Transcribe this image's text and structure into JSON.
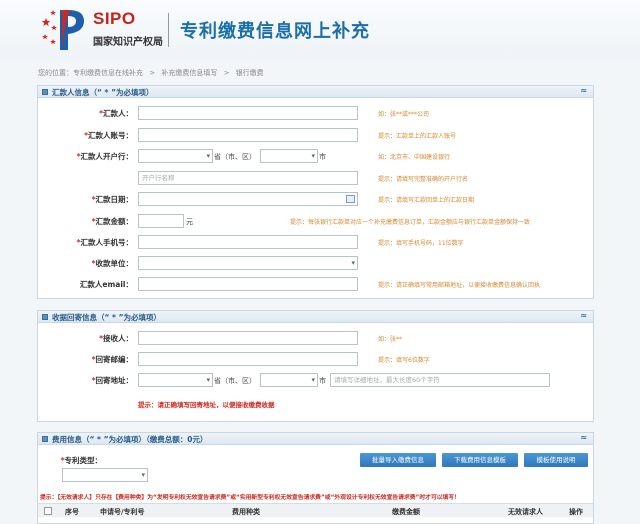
{
  "header": {
    "brand": "SIPO",
    "org": "国家知识产权局",
    "title": "专利缴费信息网上补充"
  },
  "breadcrumb": [
    "您的位置：专利缴费信息在线补充",
    ">",
    "补充缴费信息填写",
    ">",
    "银行缴费"
  ],
  "payer": {
    "title": "汇款人信息（“ * ”为必填项）",
    "collapse": "≈",
    "fields": {
      "name": {
        "label": "汇款人：",
        "hint": "如：张**或***公司"
      },
      "account": {
        "label": "汇款人账号：",
        "hint": "提示：汇款单上的汇款人账号"
      },
      "bank": {
        "label": "汇款人开户行：",
        "prov": "省（市、区）",
        "city": "市",
        "hint": "如：北京市、中国建设银行",
        "bank_placeholder": "开户行名称",
        "bank_hint": "提示：请填写完整准确的开户行名"
      },
      "date": {
        "label": "汇款日期：",
        "hint": "提示：请填写汇款回单上的汇款日期"
      },
      "amount": {
        "label": "汇款金额：",
        "unit": "元",
        "hint": "提示：每张银行汇款单对应一个补充缴费信息订单，汇款金额应与银行汇款单金额保持一致"
      },
      "phone": {
        "label": "汇款人手机号：",
        "hint": "提示：填写手机号码，11位数字"
      },
      "unit": {
        "label": "收款单位："
      },
      "email": {
        "label": "汇款人email：",
        "hint": "提示：请正确填写常用邮箱地址，以便接收缴费信息确认回执"
      }
    }
  },
  "receipt": {
    "title": "收据回寄信息（“ * ”为必填项）",
    "collapse": "≈",
    "fields": {
      "receiver": {
        "label": "接收人：",
        "hint": "如：张**"
      },
      "zip": {
        "label": "回寄邮编：",
        "hint": "提示：填写6位数字"
      },
      "addr": {
        "label": "回寄地址：",
        "prov": "省（市、区）",
        "city": "市",
        "placeholder": "请填写详细地址，最大长度60个字符"
      }
    },
    "warning": "提示：请正确填写回寄地址，以便接收缴费收据"
  },
  "fee": {
    "title": "费用信息（“ * ”为必填项）",
    "total": "（缴费总额：0元）",
    "collapse": "≈",
    "type_label": "专利类型：",
    "buttons": [
      "批量导入缴费信息",
      "下载费用信息模板",
      "模板使用说明"
    ],
    "warning": "提示：【无效请求人】只存在【费用种类】为“发明专利权无效宣告请求费”或“实用新型专利权无效宣告请求费”或“外观设计专利权无效宣告请求费”时才可以填写！",
    "columns": [
      "序号",
      "申请号/专利号",
      "费用种类",
      "缴费金额",
      "无效请求人",
      "操作"
    ]
  }
}
